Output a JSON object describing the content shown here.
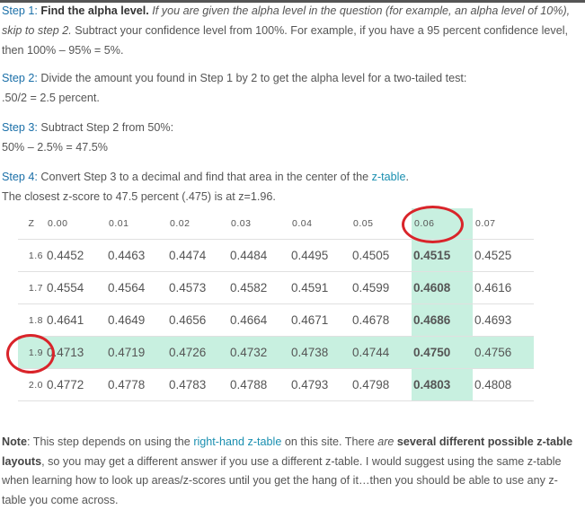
{
  "step1": {
    "label": "Step 1:",
    "heading": "Find the alpha level.",
    "italic": "If you are given the alpha level in the question (for example, an alpha level of 10%), skip to step 2.",
    "text": "Subtract your confidence level from 100%. For example, if you have a 95 percent confidence level, then 100% – 95% = 5%."
  },
  "step2": {
    "label": "Step 2:",
    "text": "Divide the amount you found in Step 1 by 2 to get the alpha level for a two-tailed test:",
    "line2": ".50/2 = 2.5 percent."
  },
  "step3": {
    "label": "Step 3:",
    "text": "Subtract Step 2 from 50%:",
    "line2": "50% – 2.5% = 47.5%"
  },
  "step4": {
    "label": "Step 4:",
    "text_before": "Convert Step 3 to a decimal and find that area in the center of the",
    "link": "z-table",
    "text_after": ".",
    "line2": "The closest z-score to 47.5 percent (.475) is at z=1.96."
  },
  "ztable": {
    "headers": [
      "Z",
      "0.00",
      "0.01",
      "0.02",
      "0.03",
      "0.04",
      "0.05",
      "0.06",
      "0.07"
    ],
    "rows": [
      {
        "z": "1.6",
        "values": [
          "0.4452",
          "0.4463",
          "0.4474",
          "0.4484",
          "0.4495",
          "0.4505",
          "0.4515",
          "0.4525"
        ]
      },
      {
        "z": "1.7",
        "values": [
          "0.4554",
          "0.4564",
          "0.4573",
          "0.4582",
          "0.4591",
          "0.4599",
          "0.4608",
          "0.4616"
        ]
      },
      {
        "z": "1.8",
        "values": [
          "0.4641",
          "0.4649",
          "0.4656",
          "0.4664",
          "0.4671",
          "0.4678",
          "0.4686",
          "0.4693"
        ]
      },
      {
        "z": "1.9",
        "values": [
          "0.4713",
          "0.4719",
          "0.4726",
          "0.4732",
          "0.4738",
          "0.4744",
          "0.4750",
          "0.4756"
        ]
      },
      {
        "z": "2.0",
        "values": [
          "0.4772",
          "0.4778",
          "0.4783",
          "0.4788",
          "0.4793",
          "0.4798",
          "0.4803",
          "0.4808"
        ]
      }
    ],
    "highlight_row": "1.9",
    "highlight_col": "0.06",
    "highlight_color": "#c8f0e0",
    "circle_color": "#d9242a"
  },
  "note": {
    "label": "Note",
    "text1": ": This step depends on using the",
    "link": "right-hand z-table",
    "text2": "on this site. There",
    "italic": "are",
    "bold": "several different possible z-table layouts",
    "text3": ", so you may get a different answer if you use a different z-table. I would suggest using the same z-table when learning how to look up areas/z-scores until you get the hang of it…then you should be able to use any z-table you come across."
  }
}
